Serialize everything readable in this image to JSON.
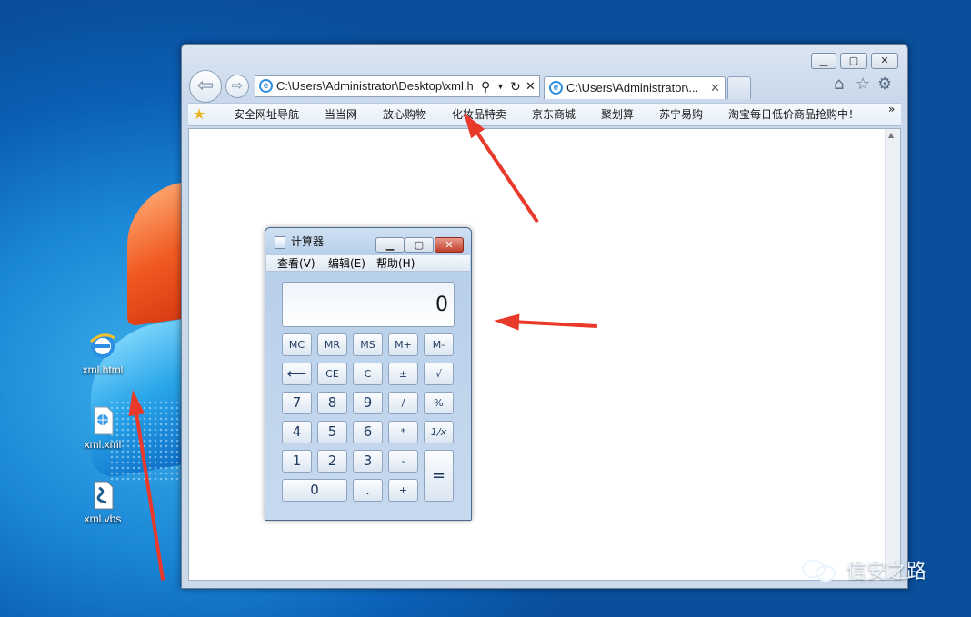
{
  "desktop": {
    "icons": [
      {
        "label": "xml.html",
        "icon": "ie-html-file-icon"
      },
      {
        "label": "xml.xml",
        "icon": "xml-file-icon"
      },
      {
        "label": "xml.vbs",
        "icon": "vbs-script-icon"
      }
    ],
    "watermark": "信安之路"
  },
  "browser": {
    "address": "C:\\Users\\Administrator\\Desktop\\xml.h",
    "tab_title": "C:\\Users\\Administrator\\...",
    "tab_close": "✕",
    "favorites": [
      "安全网址导航",
      "当当网",
      "放心购物",
      "化妆品特卖",
      "京东商城",
      "聚划算",
      "苏宁易购",
      "淘宝每日低价商品抢购中！"
    ],
    "chevron": "»"
  },
  "calculator": {
    "title": "计算器",
    "menu": [
      "查看(V)",
      "编辑(E)",
      "帮助(H)"
    ],
    "display": "0",
    "memory_row": [
      "MC",
      "MR",
      "MS",
      "M+",
      "M-"
    ],
    "row2": [
      "⟵",
      "CE",
      "C",
      "±",
      "√"
    ],
    "row3": [
      "7",
      "8",
      "9",
      "/",
      "%"
    ],
    "row4": [
      "4",
      "5",
      "6",
      "*",
      "1/x"
    ],
    "row5": [
      "1",
      "2",
      "3",
      "-"
    ],
    "row6": [
      "0",
      ".",
      "+"
    ],
    "equals": "="
  },
  "colors": {
    "arrow": "#e8392b",
    "desktop_blue": "#1a86d6"
  }
}
